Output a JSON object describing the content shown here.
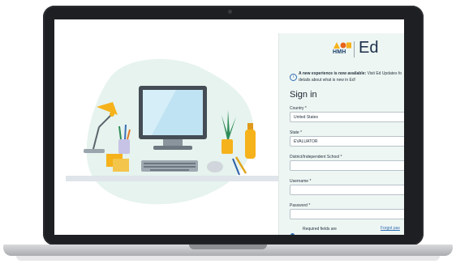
{
  "brand": {
    "company": "HMH",
    "product": "Ed"
  },
  "notice": {
    "bold": "A new experience is now available:",
    "text": " Visit Ed Updates fo",
    "line2": "details about what is new in Ed!"
  },
  "signin": {
    "title": "Sign in",
    "country_label": "Country *",
    "country_value": "United States",
    "state_label": "State *",
    "state_value": "EVALUATOR",
    "district_label": "District/Independent School *",
    "district_value": "",
    "username_label": "Username *",
    "username_value": "",
    "password_label": "Password *",
    "password_value": "",
    "required_text": "Required fields are",
    "forgot_link": "Forgot pas"
  },
  "colors": {
    "panel_bg": "#eef6f3",
    "link": "#2f6db5",
    "laptop_frame": "#1e1f22",
    "illustration_blob": "#e6f3ee"
  },
  "icons": [
    "info-icon",
    "computer-illustration",
    "desk-lamp-icon",
    "keyboard-icon",
    "mouse-icon",
    "plant-icon",
    "bottle-icon",
    "pencil-icon"
  ]
}
